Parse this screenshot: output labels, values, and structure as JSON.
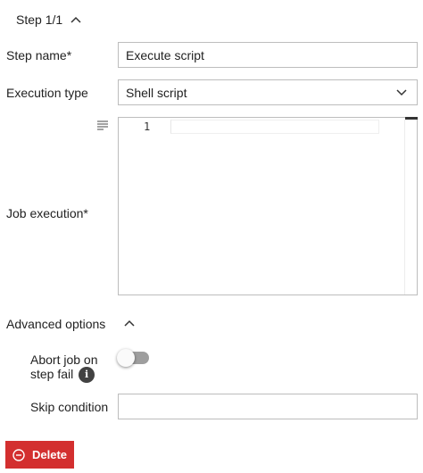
{
  "step": {
    "title": "Step 1/1",
    "collapse_icon": "chevron-up-icon"
  },
  "form": {
    "step_name": {
      "label": "Step name*",
      "value": "Execute script"
    },
    "execution_type": {
      "label": "Execution type",
      "value": "Shell script",
      "icon": "chevron-down-icon"
    },
    "job_execution": {
      "label": "Job execution*",
      "editor_icon": "align-left-icon",
      "line_number": "1",
      "code": ""
    }
  },
  "advanced": {
    "label": "Advanced options",
    "collapse_icon": "chevron-up-icon",
    "abort_job": {
      "label_line1": "Abort job on",
      "label_line2": "step fail",
      "info_icon": "info-icon",
      "info_glyph": "i",
      "enabled": false
    },
    "skip_condition": {
      "label": "Skip condition",
      "value": ""
    }
  },
  "actions": {
    "delete_label": "Delete",
    "delete_icon": "minus-circle-icon",
    "delete_color": "#d32f2f"
  }
}
